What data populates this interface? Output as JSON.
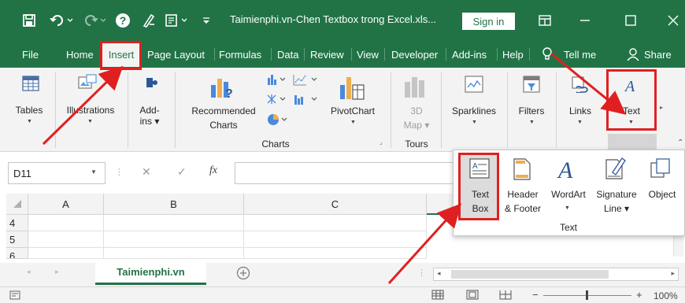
{
  "window": {
    "title": "Taimienphi.vn-Chen Textbox trong Excel.xls...",
    "sign_in": "Sign in"
  },
  "menu": {
    "tabs": [
      "File",
      "Home",
      "Insert",
      "Page Layout",
      "Formulas",
      "Data",
      "Review",
      "View",
      "Developer",
      "Add-ins",
      "Help"
    ],
    "tell_me": "Tell me",
    "share": "Share"
  },
  "ribbon": {
    "tables": "Tables",
    "illustrations": "Illustrations",
    "addins": "Add-\nins",
    "recommended_charts_1": "Recommended",
    "recommended_charts_2": "Charts",
    "pivotchart": "PivotChart",
    "map3d_1": "3D",
    "map3d_2": "Map",
    "sparklines": "Sparklines",
    "filters": "Filters",
    "links": "Links",
    "text": "Text",
    "group_charts": "Charts",
    "group_tours": "Tours"
  },
  "formula_bar": {
    "name_box": "D11",
    "fx": "fx"
  },
  "grid": {
    "columns": [
      "A",
      "B",
      "C"
    ],
    "rows": [
      "4",
      "5",
      "6"
    ]
  },
  "text_panel": {
    "items": [
      {
        "label_1": "Text",
        "label_2": "Box"
      },
      {
        "label_1": "Header",
        "label_2": "& Footer"
      },
      {
        "label_1": "WordArt",
        "label_2": ""
      },
      {
        "label_1": "Signature",
        "label_2": "Line"
      },
      {
        "label_1": "Object",
        "label_2": ""
      }
    ],
    "group_label": "Text"
  },
  "sheets": {
    "active": "Taimienphi.vn"
  },
  "status": {
    "zoom": "100%"
  },
  "colors": {
    "excel_green": "#217346",
    "highlight_red": "#e02020"
  }
}
